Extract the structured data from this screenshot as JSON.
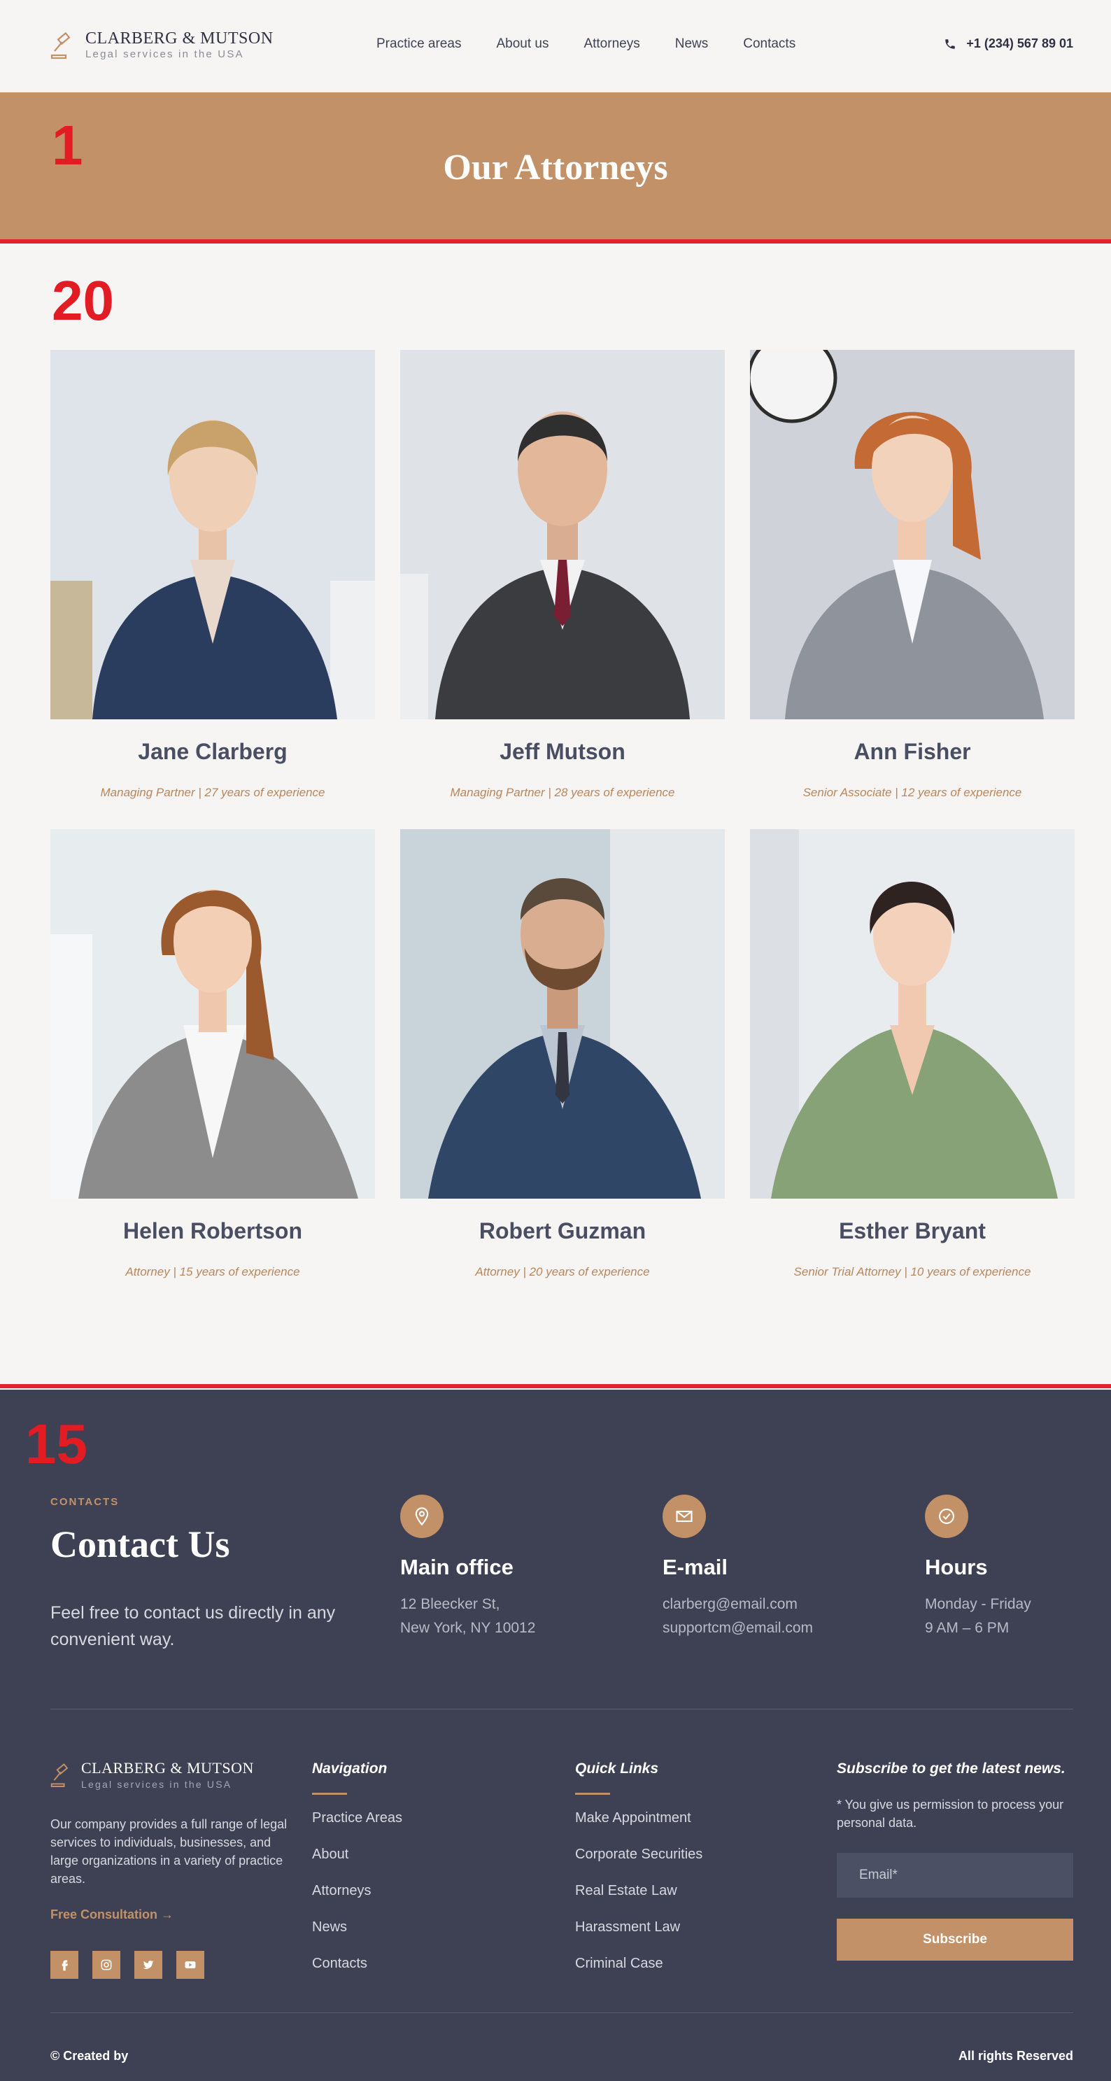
{
  "header": {
    "brand_name": "CLARBERG & MUTSON",
    "brand_tagline": "Legal services in the USA",
    "nav": [
      "Practice areas",
      "About us",
      "Attorneys",
      "News",
      "Contacts"
    ],
    "phone": "+1 (234) 567 89 01",
    "phone_icon": "phone-icon",
    "logo_icon": "gavel-icon"
  },
  "hero": {
    "title": "Our Attorneys",
    "background_color": "#c29167"
  },
  "markers": {
    "hero": "1",
    "attorneys": "20",
    "footer": "15",
    "color": "#e31b23"
  },
  "attorneys": [
    {
      "name": "Jane Clarberg",
      "role": "Managing Partner | 27 years of experience"
    },
    {
      "name": "Jeff Mutson",
      "role": "Managing Partner | 28 years of experience"
    },
    {
      "name": "Ann Fisher",
      "role": "Senior Associate | 12 years of experience"
    },
    {
      "name": "Helen Robertson",
      "role": "Attorney | 15 years of experience"
    },
    {
      "name": "Robert Guzman",
      "role": "Attorney | 20 years of experience"
    },
    {
      "name": "Esther Bryant",
      "role": "Senior Trial Attorney | 10 years of experience"
    }
  ],
  "contact": {
    "label": "CONTACTS",
    "title": "Contact Us",
    "text": "Feel free to contact us directly in any convenient way.",
    "office": {
      "title": "Main office",
      "lines": [
        "12 Bleecker St,",
        "New York, NY 10012"
      ],
      "icon": "map-pin-icon"
    },
    "email": {
      "title": "E-mail",
      "lines": [
        "clarberg@email.com",
        "supportcm@email.com"
      ],
      "icon": "envelope-icon"
    },
    "hours": {
      "title": "Hours",
      "lines": [
        "Monday - Friday",
        "9 AM – 6 PM"
      ],
      "icon": "clock-check-icon"
    }
  },
  "footer": {
    "brand_name": "CLARBERG & MUTSON",
    "brand_tagline": "Legal services in the USA",
    "description": "Our company provides a full range of legal services to individuals, businesses, and large organizations in a variety of practice areas.",
    "consultation": "Free Consultation",
    "consultation_arrow": "→",
    "socials": [
      "facebook-icon",
      "instagram-icon",
      "twitter-icon",
      "youtube-icon"
    ],
    "navigation_title": "Navigation",
    "navigation": [
      "Practice Areas",
      "About",
      "Attorneys",
      "News",
      "Contacts"
    ],
    "quick_links_title": "Quick Links",
    "quick_links": [
      "Make Appointment",
      "Corporate Securities",
      "Real Estate Law",
      "Harassment Law",
      "Criminal Case"
    ],
    "subscribe_title": "Subscribe to get the latest news.",
    "subscribe_note": "* You give us permission to process your personal data.",
    "email_placeholder": "Email*",
    "subscribe_button": "Subscribe",
    "copyright": "© Created by",
    "rights": "All rights Reserved"
  },
  "colors": {
    "accent": "#c29167",
    "footer_bg": "#3e4154",
    "page_bg": "#f6f5f4",
    "marker_line": "#e3232a"
  }
}
